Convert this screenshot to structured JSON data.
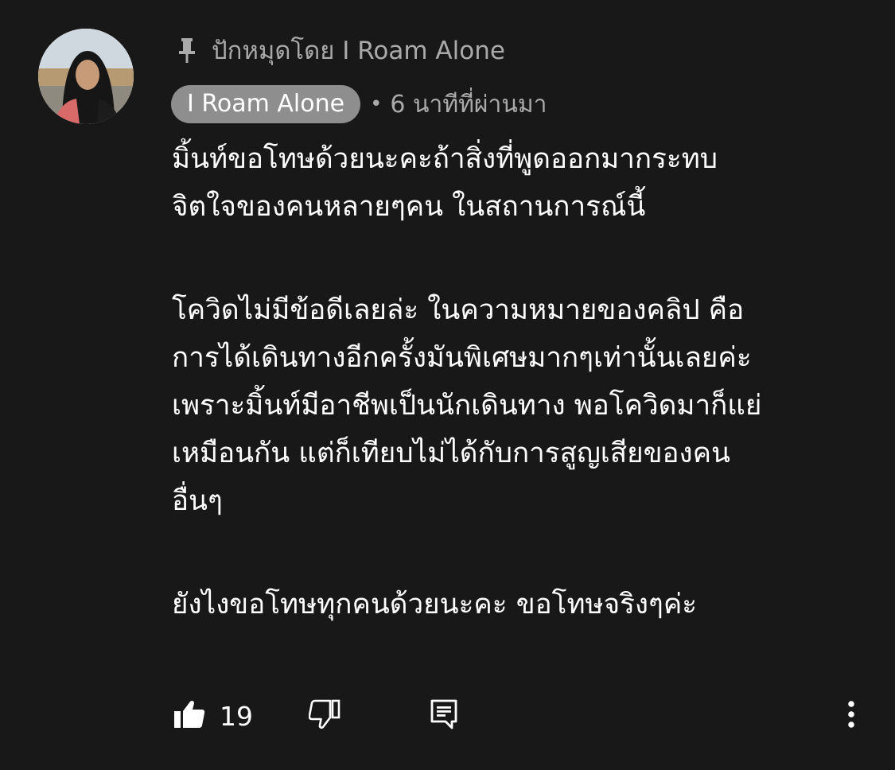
{
  "pinned": {
    "icon": "pin-icon",
    "text": "ปักหมุดโดย I Roam Alone"
  },
  "author": {
    "name": "I Roam Alone",
    "separator": "•",
    "timestamp": "6 นาทีที่ผ่านมา",
    "chip_color": "#8e8e8e"
  },
  "comment": {
    "lines": [
      "มิ้นท์ขอโทษด้วยนะคะถ้าสิ่งที่พูดออกมากระทบ",
      "จิตใจของคนหลายๆคน ในสถานการณ์นี้",
      "โควิดไม่มีข้อดีเลยล่ะ ในความหมายของคลิป คือ",
      "การได้เดินทางอีกครั้งมันพิเศษมากๆเท่านั้นเลยค่ะ",
      "เพราะมิ้นท์มีอาชีพเป็นนักเดินทาง พอโควิดมาก็แย่",
      "เหมือนกัน แต่ก็เทียบไม่ได้กับการสูญเสียของคน",
      "อื่นๆ",
      "ยังไงขอโทษทุกคนด้วยนะคะ ขอโทษจริงๆค่ะ"
    ]
  },
  "actions": {
    "like_icon": "thumbs-up-icon",
    "like_count": "19",
    "dislike_icon": "thumbs-down-icon",
    "reply_icon": "reply-comment-icon",
    "more_icon": "more-vertical-icon"
  },
  "colors": {
    "background": "#181818",
    "secondary_text": "#aaaaaa",
    "primary_text": "#ffffff"
  }
}
